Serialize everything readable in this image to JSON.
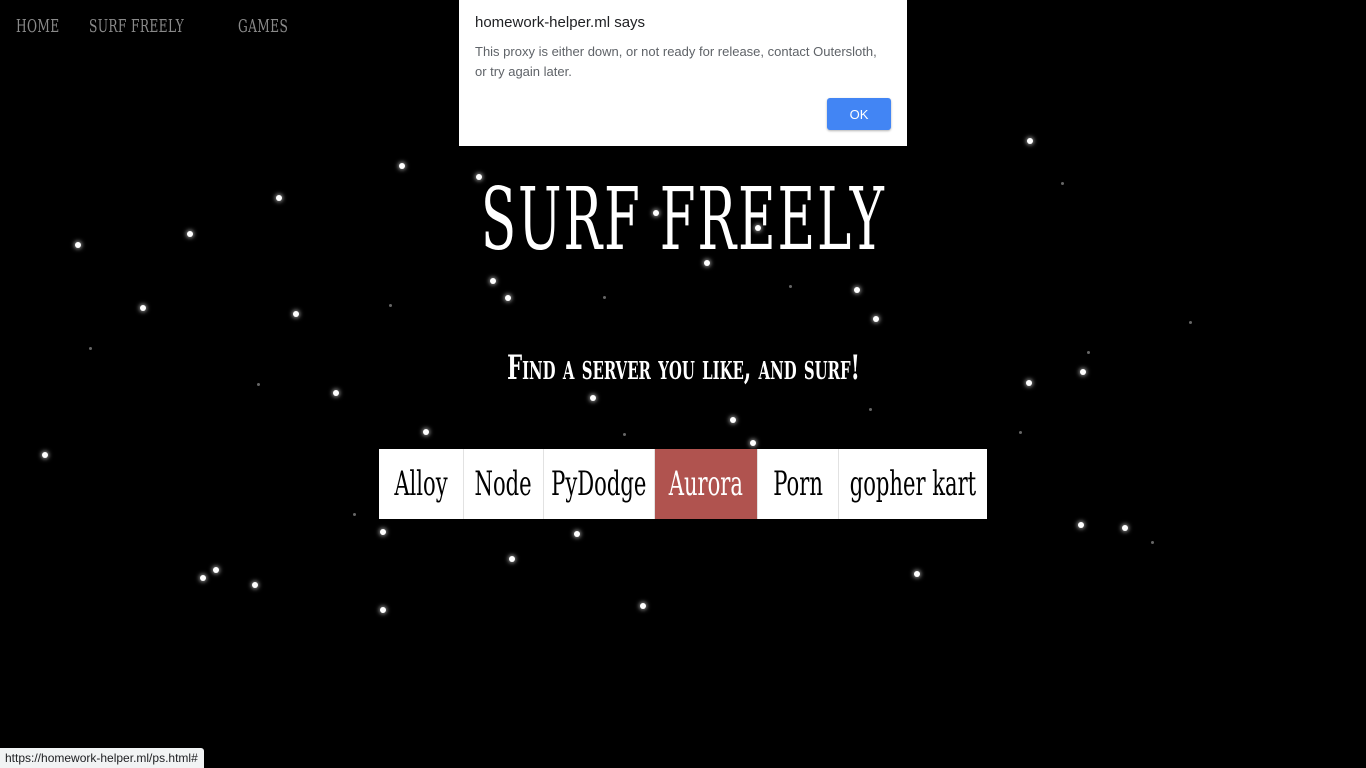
{
  "nav": {
    "items": [
      {
        "label": "Home"
      },
      {
        "label": "Surf Freely"
      },
      {
        "label": "Games"
      }
    ]
  },
  "hero": {
    "title": "Surf Freely",
    "subtitle": "Find a server you like, and surf!"
  },
  "servers": {
    "items": [
      {
        "label": "Alloy",
        "active": false
      },
      {
        "label": "Node",
        "active": false
      },
      {
        "label": "PyDodge",
        "active": false
      },
      {
        "label": "Aurora",
        "active": true
      },
      {
        "label": "Porn",
        "active": false
      },
      {
        "label": "gopher kart",
        "active": false
      }
    ],
    "active_color": "#b0534f"
  },
  "dialog": {
    "title": "homework-helper.ml says",
    "message": "This proxy is either down, or not ready for release, contact Outersloth, or try again later.",
    "ok_label": "OK",
    "ok_color": "#4285f4"
  },
  "status": {
    "url": "https://homework-helper.ml/ps.html#"
  }
}
